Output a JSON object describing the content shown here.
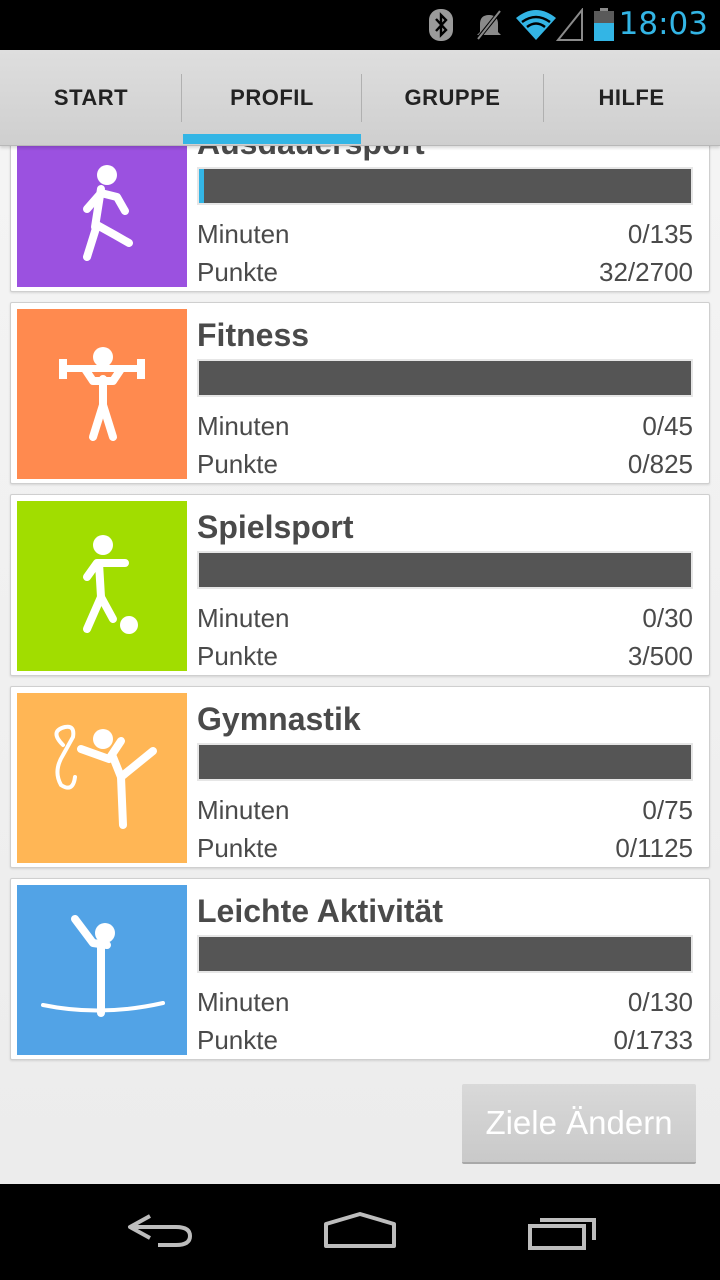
{
  "status_bar": {
    "time": "18:03",
    "icons": [
      "bluetooth-icon",
      "vibrate-icon",
      "wifi-icon",
      "signal-icon",
      "battery-icon"
    ],
    "accent_color": "#33b5e5"
  },
  "tabs": [
    {
      "label": "START",
      "selected": false
    },
    {
      "label": "PROFIL",
      "selected": true
    },
    {
      "label": "GRUPPE",
      "selected": false
    },
    {
      "label": "HILFE",
      "selected": false
    }
  ],
  "categories": [
    {
      "title": "Ausdauersport",
      "color": "#9b51e0",
      "icon": "runner-icon",
      "progress": 0.01,
      "minutes_label": "Minuten",
      "minutes": "0/135",
      "points_label": "Punkte",
      "points": "32/2700"
    },
    {
      "title": "Fitness",
      "color": "#ff8a4f",
      "icon": "weightlifter-icon",
      "progress": 0,
      "minutes_label": "Minuten",
      "minutes": "0/45",
      "points_label": "Punkte",
      "points": "0/825"
    },
    {
      "title": "Spielsport",
      "color": "#a1dd00",
      "icon": "soccer-player-icon",
      "progress": 0,
      "minutes_label": "Minuten",
      "minutes": "0/30",
      "points_label": "Punkte",
      "points": "3/500"
    },
    {
      "title": "Gymnastik",
      "color": "#ffb655",
      "icon": "gymnast-icon",
      "progress": 0,
      "minutes_label": "Minuten",
      "minutes": "0/75",
      "points_label": "Punkte",
      "points": "0/1125"
    },
    {
      "title": "Leichte Aktivität",
      "color": "#52a3e6",
      "icon": "balance-walker-icon",
      "progress": 0,
      "minutes_label": "Minuten",
      "minutes": "0/130",
      "points_label": "Punkte",
      "points": "0/1733"
    }
  ],
  "actions": {
    "change_goals_label": "Ziele Ändern"
  },
  "nav_bar": {
    "icons": [
      "back-icon",
      "home-icon",
      "recent-apps-icon"
    ]
  }
}
